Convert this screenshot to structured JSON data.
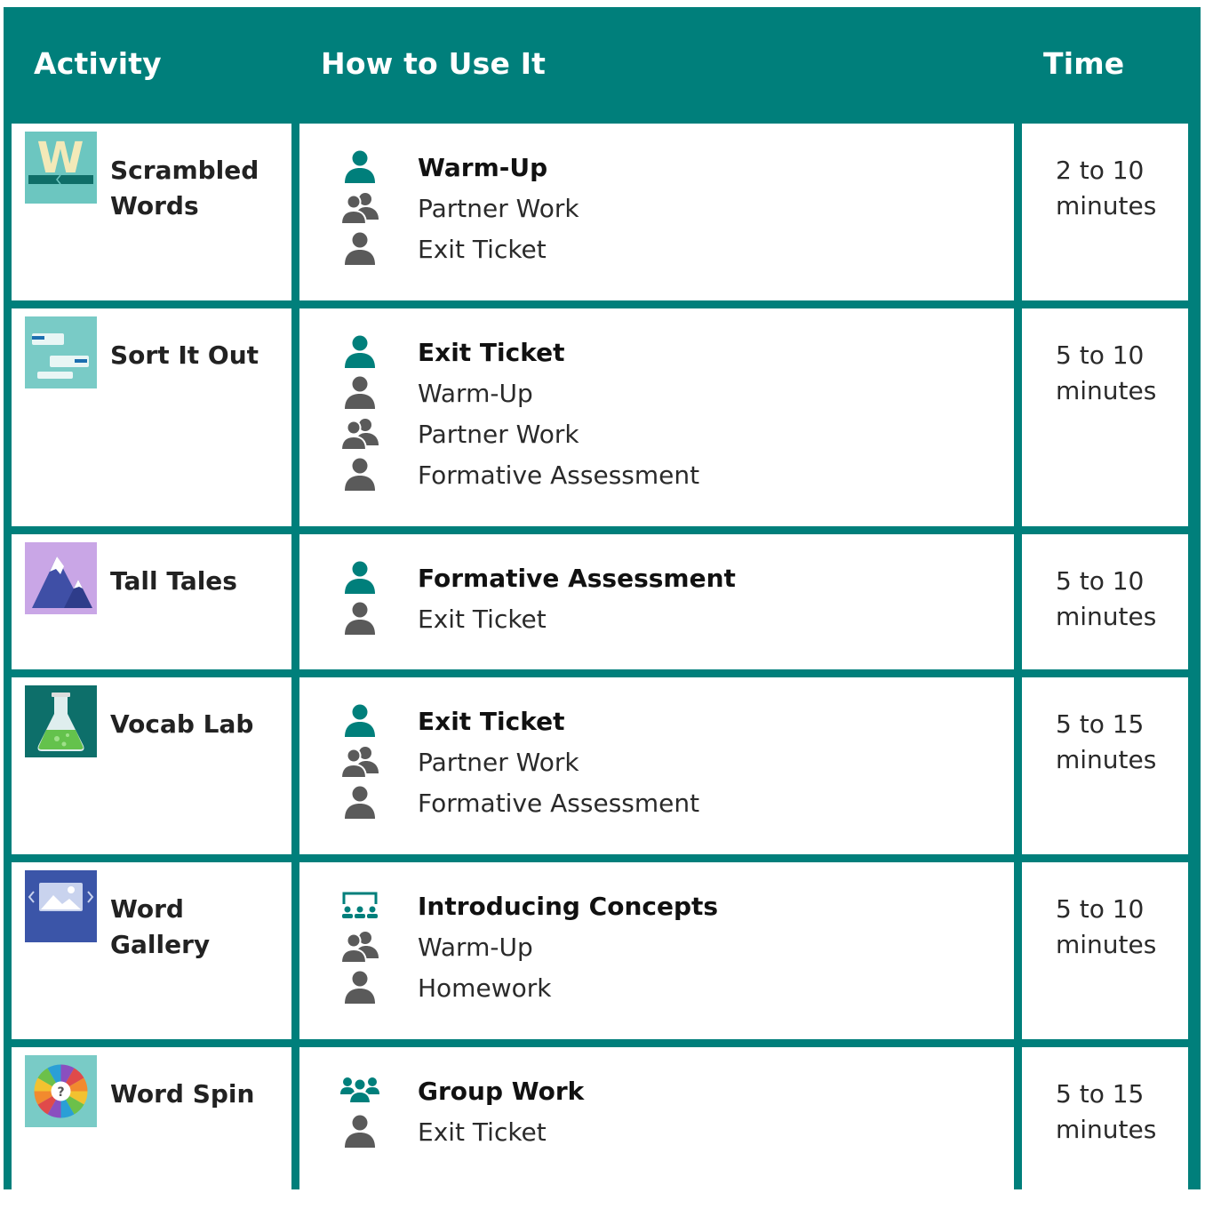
{
  "colors": {
    "frame": "#007f7b",
    "header_text": "#ffffff",
    "icon_primary": "#007f7b",
    "icon_secondary": "#5a5a5a"
  },
  "header": {
    "activity": "Activity",
    "how": "How to Use It",
    "time": "Time"
  },
  "rows": [
    {
      "name": "Scrambled Words",
      "thumb_icon": "scrambled-words-thumbnail",
      "uses": [
        {
          "icon": "person-icon",
          "label": "Warm-Up"
        },
        {
          "icon": "partner-icon",
          "label": "Partner Work"
        },
        {
          "icon": "person-icon",
          "label": "Exit Ticket"
        }
      ],
      "time": "2 to 10 minutes"
    },
    {
      "name": "Sort It Out",
      "thumb_icon": "sort-it-out-thumbnail",
      "uses": [
        {
          "icon": "person-icon",
          "label": "Exit Ticket"
        },
        {
          "icon": "person-icon",
          "label": "Warm-Up"
        },
        {
          "icon": "partner-icon",
          "label": "Partner Work"
        },
        {
          "icon": "person-icon",
          "label": "Formative Assessment"
        }
      ],
      "time": "5 to 10 minutes"
    },
    {
      "name": "Tall Tales",
      "thumb_icon": "tall-tales-thumbnail",
      "uses": [
        {
          "icon": "person-icon",
          "label": "Formative Assessment"
        },
        {
          "icon": "person-icon",
          "label": "Exit Ticket"
        }
      ],
      "time": "5 to 10 minutes"
    },
    {
      "name": "Vocab Lab",
      "thumb_icon": "vocab-lab-thumbnail",
      "uses": [
        {
          "icon": "person-icon",
          "label": "Exit Ticket"
        },
        {
          "icon": "partner-icon",
          "label": "Partner Work"
        },
        {
          "icon": "person-icon",
          "label": "Formative Assessment"
        }
      ],
      "time": "5 to 15 minutes"
    },
    {
      "name": "Word Gallery",
      "thumb_icon": "word-gallery-thumbnail",
      "uses": [
        {
          "icon": "classroom-icon",
          "label": "Introducing Concepts"
        },
        {
          "icon": "partner-icon",
          "label": "Warm-Up"
        },
        {
          "icon": "person-icon",
          "label": "Homework"
        }
      ],
      "time": "5 to 10 minutes"
    },
    {
      "name": "Word Spin",
      "thumb_icon": "word-spin-thumbnail",
      "uses": [
        {
          "icon": "group-icon",
          "label": "Group Work"
        },
        {
          "icon": "person-icon",
          "label": "Exit Ticket"
        }
      ],
      "time": "5 to 15 minutes"
    }
  ]
}
